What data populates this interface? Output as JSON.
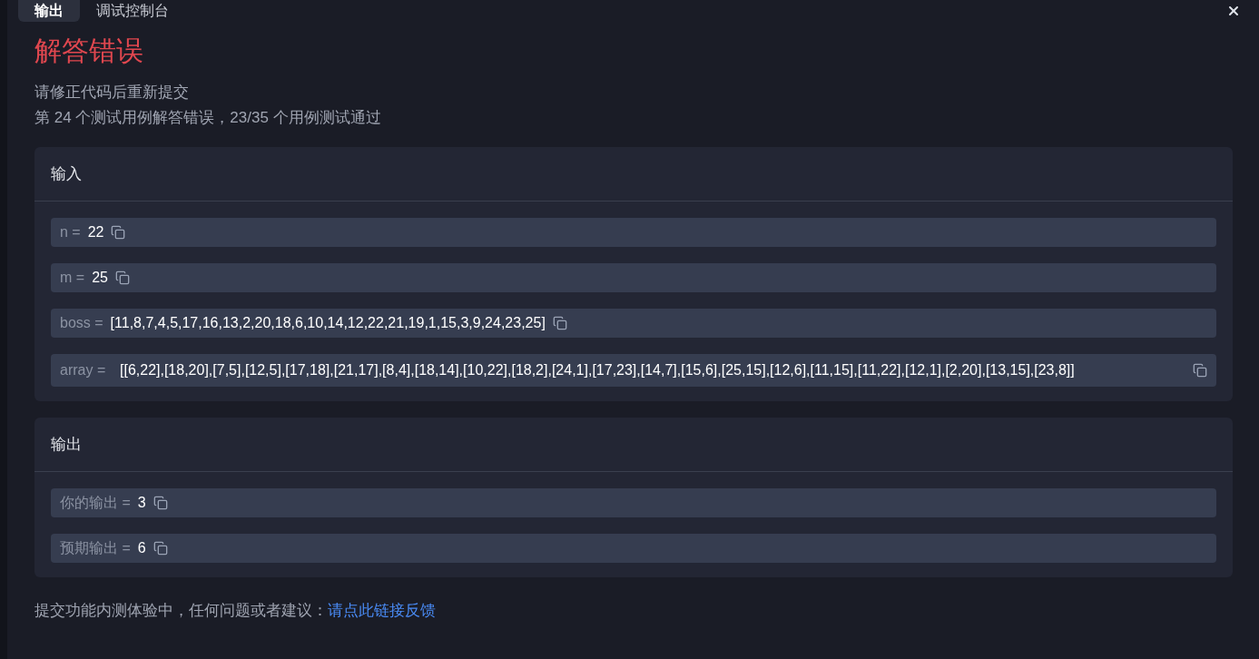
{
  "tabs": [
    {
      "label": "输出",
      "selected": true
    },
    {
      "label": "调试控制台",
      "selected": false
    }
  ],
  "result": {
    "title": "解答错误",
    "lines": [
      "请修正代码后重新提交",
      "第 24 个测试用例解答错误，23/35 个用例测试通过"
    ]
  },
  "sections": [
    {
      "title": "输入",
      "rows": [
        {
          "kind": "inline",
          "label": "n =",
          "value": "22"
        },
        {
          "kind": "inline",
          "label": "m =",
          "value": "25"
        },
        {
          "kind": "inline",
          "label": "boss =",
          "value": "[11,8,7,4,5,17,16,13,2,20,18,6,10,14,12,22,21,19,1,15,3,9,24,23,25]"
        },
        {
          "kind": "wrapped",
          "label": "array =",
          "value": "[[6,22],[18,20],[7,5],[12,5],[17,18],[21,17],[8,4],[18,14],[10,22],[18,2],[24,1],[17,23],[14,7],[15,6],[25,15],[12,6],[11,15],[11,22],[12,1],[2,20],[13,15],[23,8]]"
        }
      ]
    },
    {
      "title": "输出",
      "rows": [
        {
          "kind": "inline",
          "label": "你的输出 =",
          "value": "3"
        },
        {
          "kind": "inline",
          "label": "预期输出 =",
          "value": "6"
        }
      ]
    }
  ],
  "footer": {
    "text": "提交功能内测体验中，任何问题或者建议：",
    "link": "请点此链接反馈"
  }
}
